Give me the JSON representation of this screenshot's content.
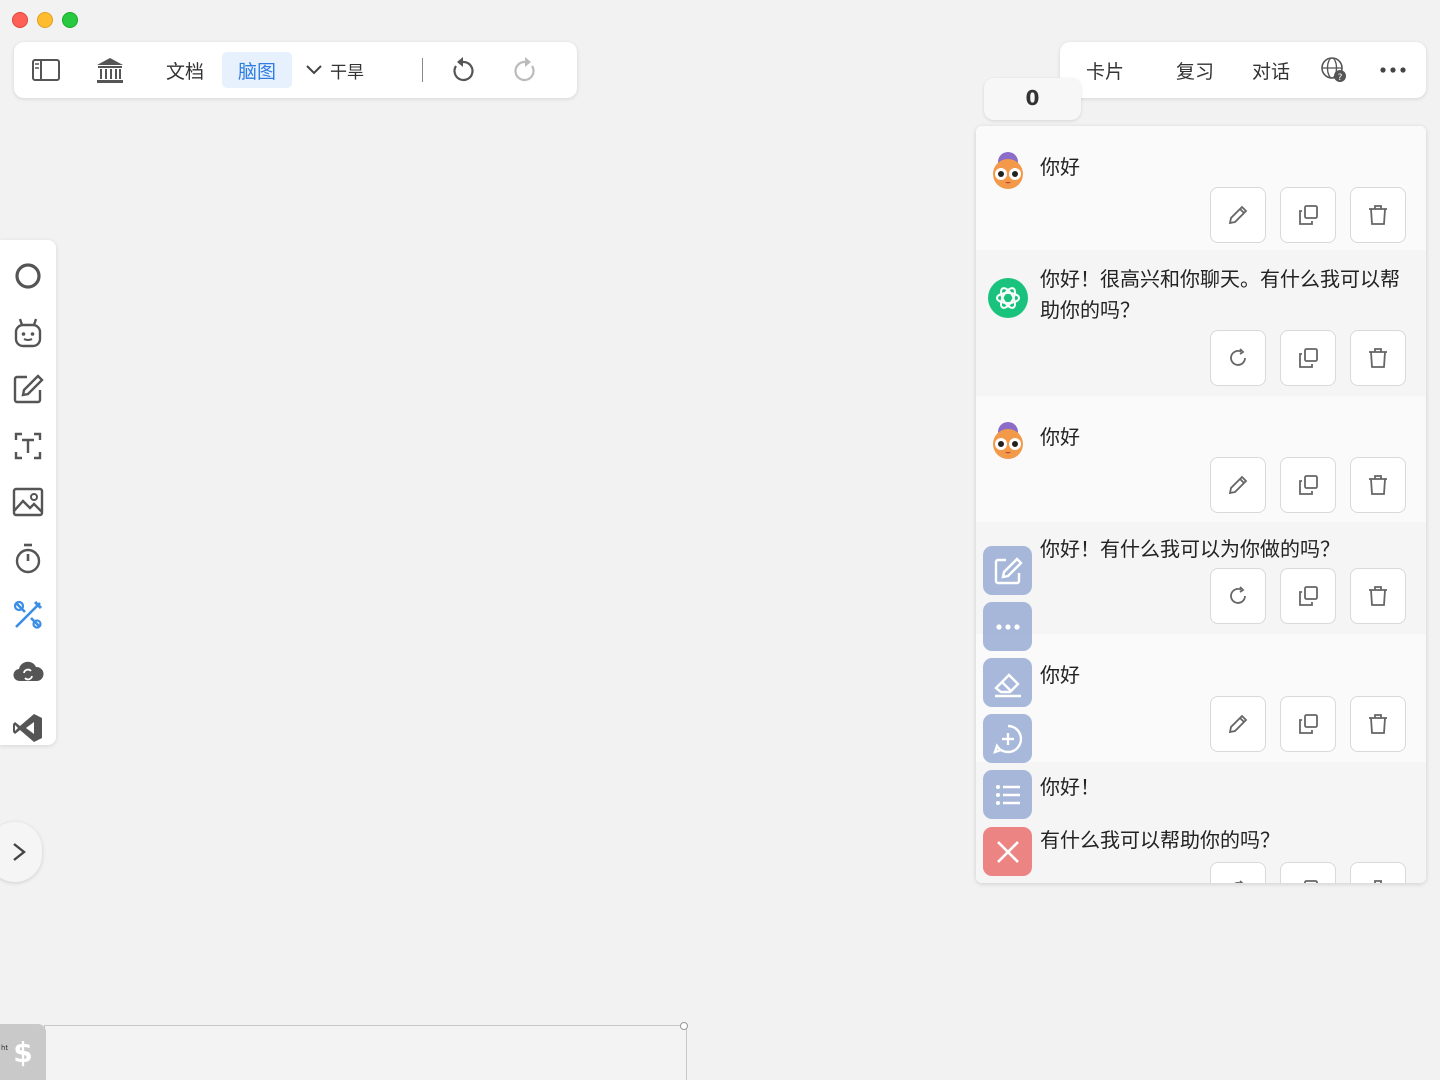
{
  "window": {
    "traffic_lights": [
      "close",
      "minimize",
      "zoom"
    ]
  },
  "toolbar_left": {
    "doc_tab": "文档",
    "mindmap_tab": "脑图",
    "dropdown_value": "干旱",
    "accent_color": "#2f7de1"
  },
  "toolbar_right": {
    "cards": "卡片",
    "review": "复习",
    "dialogue": "对话"
  },
  "counter": "0",
  "side_tools": [
    "circle-icon",
    "robot-icon",
    "edit-icon",
    "text-select-icon",
    "image-icon",
    "timer-icon",
    "tools-icon",
    "cloud-sync-icon",
    "vscode-icon"
  ],
  "chat": {
    "messages": [
      {
        "role": "user",
        "text": "你好"
      },
      {
        "role": "assistant",
        "text": "你好！很高兴和你聊天。有什么我可以帮助你的吗？"
      },
      {
        "role": "user",
        "text": "你好"
      },
      {
        "role": "assistant",
        "text": "你好！有什么我可以为你做的吗？"
      },
      {
        "role": "user",
        "text": "你好"
      },
      {
        "role": "assistant",
        "text_line1": "你好！",
        "text_line2": "有什么我可以帮助你的吗？"
      }
    ]
  },
  "bottom": {
    "dollar": "$",
    "tiny_label": "ht"
  }
}
